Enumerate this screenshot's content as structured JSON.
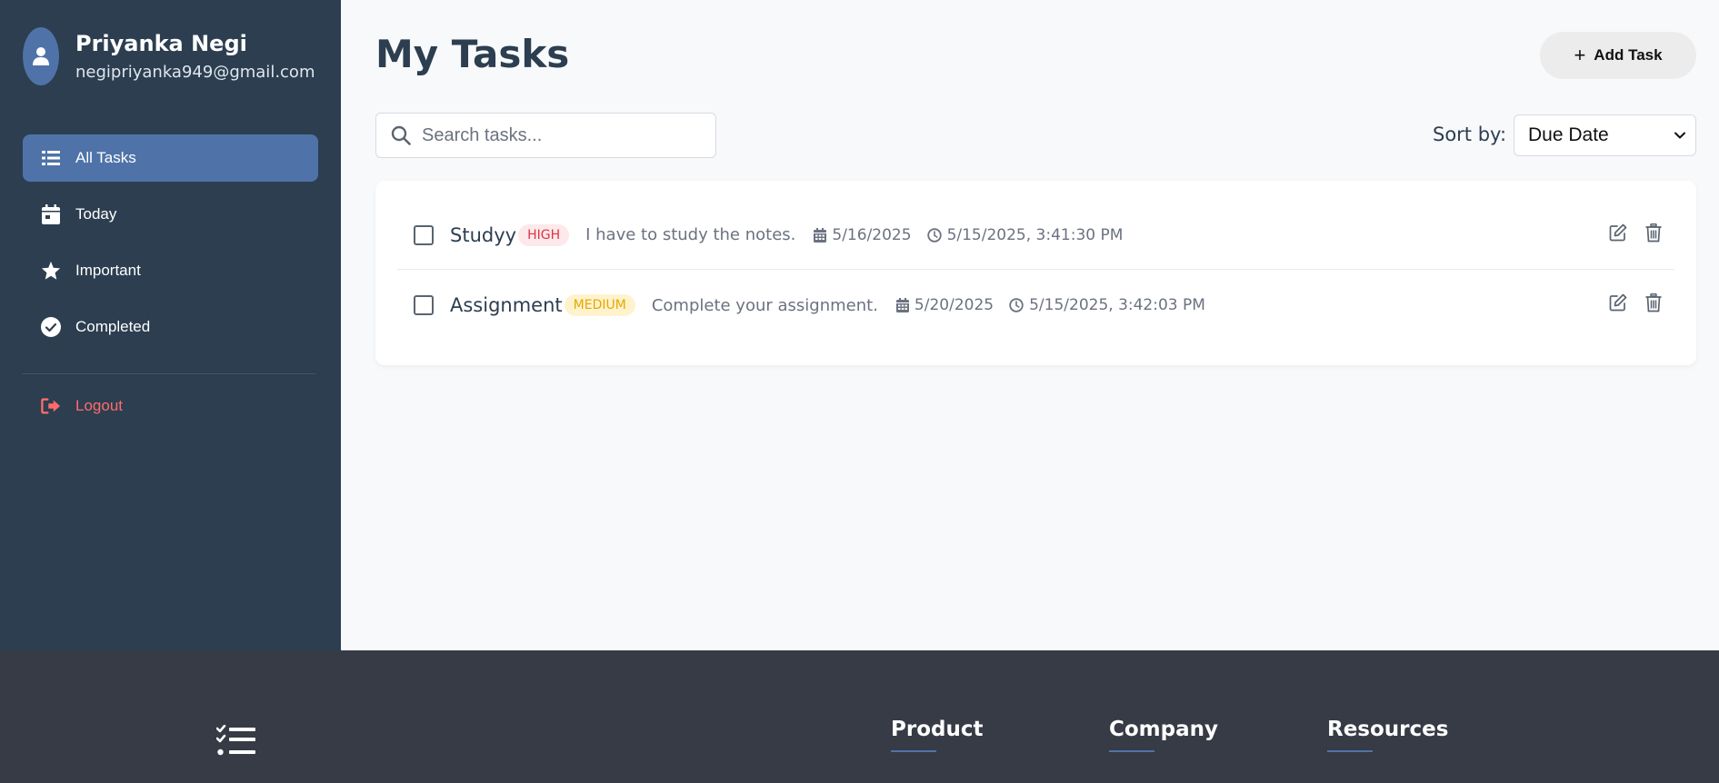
{
  "profile": {
    "name": "Priyanka Negi",
    "email": "negipriyanka949@gmail.com"
  },
  "sidebar": {
    "items": [
      {
        "label": "All Tasks",
        "icon": "list-icon",
        "active": true
      },
      {
        "label": "Today",
        "icon": "calendar-icon",
        "active": false
      },
      {
        "label": "Important",
        "icon": "star-icon",
        "active": false
      },
      {
        "label": "Completed",
        "icon": "check-circle-icon",
        "active": false
      }
    ],
    "logout_label": "Logout"
  },
  "main": {
    "title": "My Tasks",
    "add_task_label": "Add Task",
    "search_placeholder": "Search tasks...",
    "sort_label": "Sort by:",
    "sort_value": "Due Date"
  },
  "tasks": [
    {
      "title": "Studyy",
      "priority": "HIGH",
      "description": "I have to study the notes.",
      "due_date": "5/16/2025",
      "created": "5/15/2025, 3:41:30 PM",
      "completed": false
    },
    {
      "title": "Assignment",
      "priority": "MEDIUM",
      "description": "Complete your assignment.",
      "due_date": "5/20/2025",
      "created": "5/15/2025, 3:42:03 PM",
      "completed": false
    }
  ],
  "footer": {
    "columns": [
      {
        "heading": "Product"
      },
      {
        "heading": "Company"
      },
      {
        "heading": "Resources"
      }
    ]
  },
  "colors": {
    "sidebar_bg": "#2c3e50",
    "accent": "#4f73a8",
    "logout": "#ff6b6b",
    "high": "#dc3545",
    "medium": "#e5a800",
    "footer_bg": "#363b45"
  }
}
